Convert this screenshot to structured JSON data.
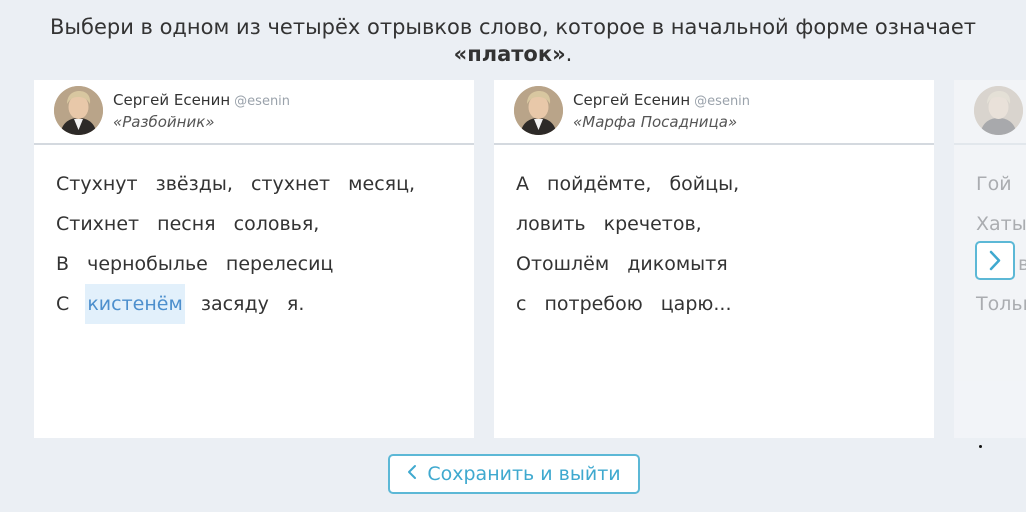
{
  "instruction": {
    "text": "Выбери в одном из четырёх отрывков слово, которое в начальной форме означает",
    "keyword": "«платок»",
    "suffix": "."
  },
  "cards": [
    {
      "author": "Сергей Есенин",
      "handle": "@esenin",
      "work": "«Разбойник»",
      "lines": [
        [
          "Стухнут",
          "звёзды,",
          "стухнет",
          "месяц,"
        ],
        [
          "Стихнет",
          "песня",
          "соловья,"
        ],
        [
          "В",
          "чернобылье",
          "перелесиц"
        ],
        [
          "С",
          "кистенём",
          "засяду",
          "я."
        ]
      ],
      "selected_word": "кистенём"
    },
    {
      "author": "Сергей Есенин",
      "handle": "@esenin",
      "work": "«Марфа Посадница»",
      "lines": [
        [
          "А",
          "пойдёмте,",
          "бойцы,"
        ],
        [
          "ловить",
          "кречетов,"
        ],
        [
          "Отошлём",
          "дикомытя"
        ],
        [
          "с",
          "потребою",
          "царю..."
        ]
      ]
    },
    {
      "lines": [
        [
          "Гой"
        ],
        [
          "Хаты"
        ],
        [
          "в"
        ],
        [
          "Тольк"
        ]
      ]
    }
  ],
  "buttons": {
    "save_label": "Сохранить и выйти"
  },
  "colors": {
    "accent": "#5cb8d6",
    "selected_bg": "#e2f0fb",
    "selected_text": "#4d8fcd",
    "background": "#ebeff4"
  },
  "icons": {
    "next": "chevron-right-icon",
    "back": "chevron-left-icon"
  }
}
